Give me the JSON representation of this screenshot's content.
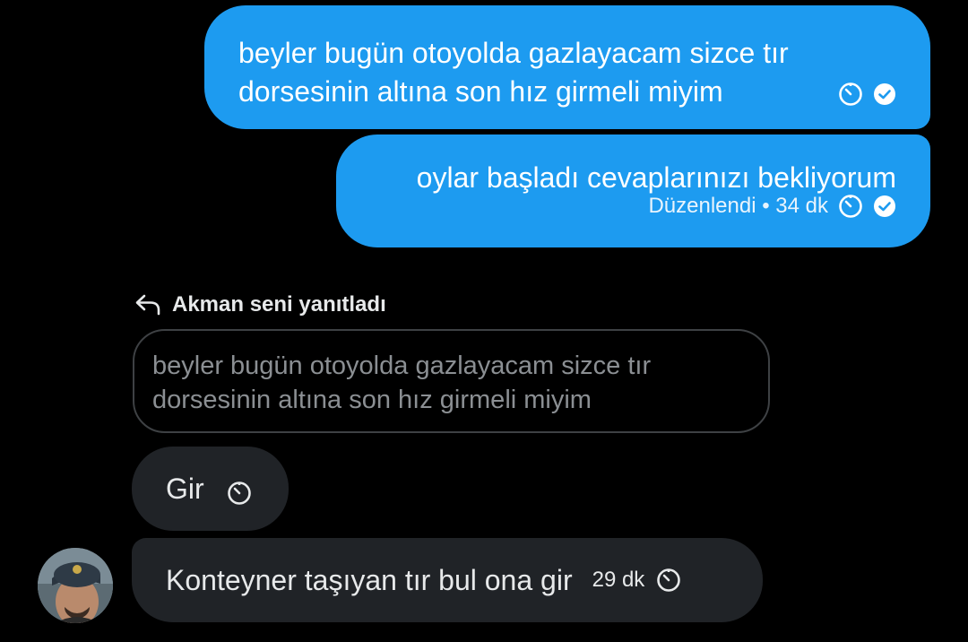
{
  "messages_out": [
    {
      "text_line1": "beyler bugün otoyolda gazlayacam sizce tır",
      "text_line2": "dorsesinin altına son hız girmeli miyim"
    },
    {
      "text": "oylar başladı cevaplarınızı bekliyorum",
      "meta": "Düzenlendi • 34 dk"
    }
  ],
  "reply": {
    "header": "Akman seni yanıtladı",
    "quoted_line1": "beyler bugün otoyolda gazlayacam sizce tır",
    "quoted_line2": "dorsesinin altına son hız girmeli miyim"
  },
  "messages_in": [
    {
      "text": "Gir"
    },
    {
      "text": "Konteyner taşıyan tır bul ona gir",
      "time": "29 dk"
    }
  ],
  "icons": {
    "clock": "disappearing-clock-icon",
    "check": "seen-check-icon",
    "reply": "reply-arrow-icon"
  },
  "colors": {
    "outgoing_bubble": "#1d9bf0",
    "incoming_bubble": "#202327",
    "background": "#000000"
  }
}
